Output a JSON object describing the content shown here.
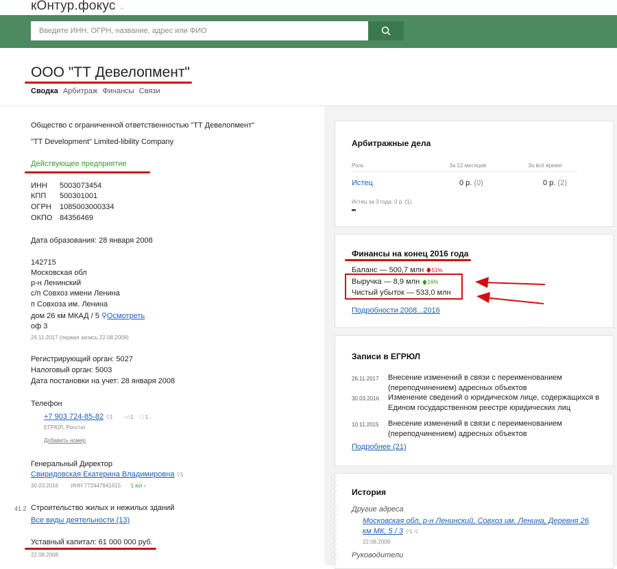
{
  "app": {
    "logo_text": "кОнтур.фокус",
    "logo_chevron": "⌄"
  },
  "search": {
    "placeholder": "Введите ИНН, ОГРН, название, адрес или ФИО"
  },
  "company": {
    "title": "ООО \"ТТ Девелопмент\"",
    "tabs": [
      "Сводка",
      "Арбитраж",
      "Финансы",
      "Связи"
    ],
    "full_name": "Общество с ограниченной ответственностью \"ТТ Девелопмент\"",
    "eng_name": "\"TT Development\" Limited-libility Company",
    "status": "Действующее предприятие",
    "ids": [
      {
        "label": "ИНН",
        "value": "5003073454"
      },
      {
        "label": "КПП",
        "value": "500301001"
      },
      {
        "label": "ОГРН",
        "value": "1085003000334"
      },
      {
        "label": "ОКПО",
        "value": "84356469"
      }
    ],
    "founded": "Дата образования: 28 января 2008",
    "address_lines": [
      "142715",
      "Московская обл",
      "р-н Ленинский",
      "с/п Совхоз имени Ленина",
      "п Совхоза им. Ленина"
    ],
    "address_house": "дом 26 км МКАД / 5",
    "address_view_link": "Осмотреть",
    "address_office": "оф 3",
    "address_date": "26.11.2017 (первая запись 22.08.2008)",
    "reg_lines": [
      "Регистрирующий орган: 5027",
      "Налоговый орган: 5003",
      "Дата постановки на учет: 28 января 2008"
    ],
    "phone_label": "Телефон",
    "phone": "+7 903 724-85-82",
    "phone_searches": "1",
    "phone_likes": "1",
    "phone_comments": "1",
    "phone_source": "ЕГРЮЛ, Росстат",
    "add_phone": "Добавить номер",
    "director_label": "Генеральный Директор",
    "director_name": "Свиридовская Екатерина Владимировна",
    "director_searches": "1",
    "director_date": "30.03.2016",
    "director_inn": "ИНН 772447941615",
    "director_related": "1 юл",
    "okved_code": "41.2",
    "okved_text": "Строительство жилых и нежилых зданий",
    "all_activities": "Все виды деятельности (13)",
    "capital": "Уставный капитал: 61 000 000 руб.",
    "capital_date": "22.08.2008"
  },
  "arbitration": {
    "title": "Арбитражные дела",
    "col_role": "Роль",
    "col_12m": "За 12 месяцев",
    "col_all": "За всё время",
    "row_role": "Истец",
    "row_12m": "0 р.",
    "row_12m_count": "(0)",
    "row_all": "0 р.",
    "row_all_count": "(2)",
    "note": "Истец за 3 года: 0 р. (1)"
  },
  "finance": {
    "title": "Финансы на конец 2016 года",
    "balance": "Баланс — 500,7 млн",
    "balance_change": "51%",
    "revenue": "Выручка — 8,9 млн",
    "revenue_change": "16%",
    "loss": "Чистый убыток — 533,0 млн",
    "details_link": "Подробности 2008...2016"
  },
  "egrul": {
    "title": "Записи в ЕГРЮЛ",
    "entries": [
      {
        "date": "26.11.2017",
        "line1": "Внесение изменений в связи с переименованием",
        "line2": "(переподчинением) адресных объектов"
      },
      {
        "date": "30.03.2016",
        "line1": "Изменение сведений о юридическом лице, содержащихся в",
        "line2": "Едином государственном реестре юридических лиц"
      },
      {
        "date": "10.11.2015",
        "line1": "Внесение изменений в связи с переименованием",
        "line2": "(переподчинением) адресных объектов"
      }
    ],
    "more_link": "Подробнее (21)"
  },
  "history": {
    "title": "История",
    "other_addresses": "Другие адреса",
    "address_line1": "Московская обл, р-н Ленинский, Совхоз им. Ленина, Деревня 26",
    "address_line2": "км МК, 5 / 3",
    "address_searches": "1",
    "address_date": "22.08.2008",
    "leaders": "Руководители"
  },
  "colors": {
    "header_green": "#4d8a5f",
    "accent_red": "#d01010",
    "link_blue": "#1a5fb4",
    "status_green": "#3a9a2a"
  }
}
